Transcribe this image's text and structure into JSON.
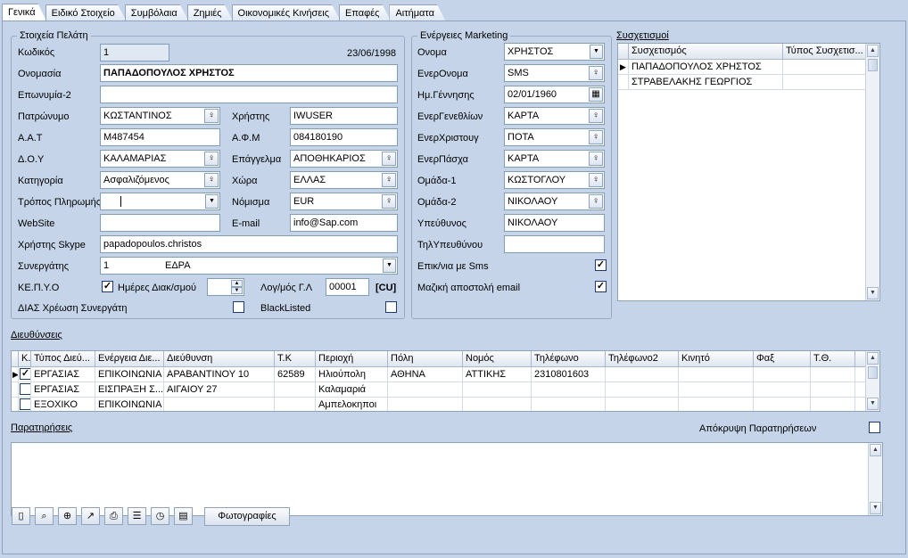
{
  "tabs": [
    "Γενικά",
    "Ειδικό Στοιχείο",
    "Συμβόλαια",
    "Ζημιές",
    "Οικονομικές Κινήσεις",
    "Επαφές",
    "Αιτήματα"
  ],
  "customer": {
    "title": "Στοιχεία Πελάτη",
    "date": "23/06/1998",
    "code_label": "Κωδικός",
    "code": "1",
    "name_label": "Ονομασία",
    "name": "ΠΑΠΑΔΟΠΟΥΛΟΣ ΧΡΗΣΤΟΣ",
    "brand_label": "Επωνυμία-2",
    "brand": "",
    "father_label": "Πατρώνυμο",
    "father": "ΚΩΣΤΑΝΤΙΝΟΣ",
    "user_label": "Χρήστης",
    "user": "IWUSER",
    "aat_label": "Α.Α.Τ",
    "aat": "M487454",
    "afm_label": "Α.Φ.Μ",
    "afm": "084180190",
    "doy_label": "Δ.Ο.Υ",
    "doy": "ΚΑΛΑΜΑΡΙΑΣ",
    "job_label": "Επάγγελμα",
    "job": "ΑΠΟΘΗΚΑΡΙΟΣ",
    "cat_label": "Κατηγορία",
    "cat": "Ασφαλιζόμενος",
    "country_label": "Χώρα",
    "country": "ΕΛΛΑΣ",
    "pay_label": "Τρόπος Πληρωμής",
    "pay": "",
    "currency_label": "Νόμισμα",
    "currency": "EUR",
    "web_label": "WebSite",
    "web": "",
    "email_label": "E-mail",
    "email": "info@Sap.com",
    "skype_label": "Χρήστης Skype",
    "skype": "papadopoulos.christos",
    "partner_label": "Συνεργάτης",
    "partner_code": "1",
    "partner": "ΕΔΡΑ",
    "kepyo_label": "ΚΕ.Π.Υ.Ο",
    "days_label": "Ημέρες Διακ/σμού",
    "days": "",
    "ledger_label": "Λογ/μός Γ.Λ",
    "ledger": "00001",
    "ledger_suffix": "[CU]",
    "dias_label": "ΔΙΑΣ Χρέωση Συνεργάτη",
    "blacklisted_label": "BlackListed"
  },
  "marketing": {
    "title": "Ενέργειες Marketing",
    "fields": [
      {
        "label": "Ονομα",
        "value": "ΧΡΗΣΤΟΣ",
        "kind": "dd"
      },
      {
        "label": "ΕνερΟνομα",
        "value": "SMS",
        "kind": "pick"
      },
      {
        "label": "Ημ.Γέννησης",
        "value": "02/01/1960",
        "kind": "cal"
      },
      {
        "label": "ΕνερΓενεθλίων",
        "value": "ΚΑΡΤΑ",
        "kind": "pick"
      },
      {
        "label": "ΕνερΧριστουγ",
        "value": "ΠΟΤΑ",
        "kind": "pick"
      },
      {
        "label": "ΕνερΠάσχα",
        "value": "ΚΑΡΤΑ",
        "kind": "pick"
      },
      {
        "label": "Ομάδα-1",
        "value": "ΚΩΣΤΟΓΛΟΥ",
        "kind": "pick"
      },
      {
        "label": "Ομάδα-2",
        "value": "ΝΙΚΟΛΑΟΥ",
        "kind": "pick"
      },
      {
        "label": "Υπεύθυνος",
        "value": "ΝΙΚΟΛΑΟΥ",
        "kind": "plain"
      },
      {
        "label": "ΤηλΥπευθύνου",
        "value": "",
        "kind": "plain"
      }
    ],
    "sms_label": "Επικ/νια με Sms",
    "email_label": "Μαζική αποστολή email"
  },
  "relations": {
    "title": "Συσχετισμοί",
    "headers": [
      "Συσχετισμός",
      "Τύπος Συσχετισ..."
    ],
    "rows": [
      [
        "ΠΑΠΑΔΟΠΟΥΛΟΣ ΧΡΗΣΤΟΣ",
        ""
      ],
      [
        "ΣΤΡΑΒΕΛΑΚΗΣ ΓΕΩΡΓΙΟΣ",
        ""
      ]
    ]
  },
  "addresses": {
    "title": "Διευθύνσεις",
    "headers": [
      "Κ..",
      "Τύπος Διεύ...",
      "Ενέργεια Διε...",
      "Διεύθυνση",
      "Τ.Κ",
      "Περιοχή",
      "Πόλη",
      "Νομός",
      "Τηλέφωνο",
      "Τηλέφωνο2",
      "Κινητό",
      "Φαξ",
      "Τ.Θ."
    ],
    "rows": [
      [
        "ΕΡΓΑΣΙΑΣ",
        "ΕΠΙΚΟΙΝΩΝΙΑ",
        "ΑΡΑΒΑΝΤΙΝΟΥ 10",
        "62589",
        "Ηλιούπολη",
        "ΑΘΗΝΑ",
        "ΑΤΤΙΚΗΣ",
        "2310801603",
        "",
        "",
        "",
        ""
      ],
      [
        "ΕΡΓΑΣΙΑΣ",
        "ΕΙΣΠΡΑΞΗ Σ...",
        "ΑΙΓΑΙΟΥ 27",
        "",
        "Καλαμαριά",
        "",
        "",
        "",
        "",
        "",
        "",
        ""
      ],
      [
        "ΕΞΟΧΙΚΟ",
        "ΕΠΙΚΟΙΝΩΝΙΑ",
        "",
        "",
        "Αμπελοκηποι",
        "",
        "",
        "",
        "",
        "",
        "",
        ""
      ]
    ]
  },
  "notes": {
    "title": "Παρατηρήσεις",
    "hide_label": "Απόκρυψη Παρατηρήσεων",
    "text": ""
  },
  "photos_label": "Φωτογραφίες"
}
